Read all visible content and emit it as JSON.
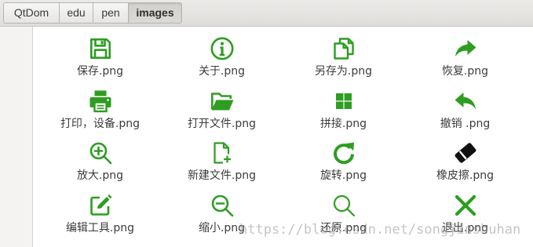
{
  "pathbar": {
    "segments": [
      {
        "label": "QtDom",
        "active": false
      },
      {
        "label": "edu",
        "active": false
      },
      {
        "label": "pen",
        "active": false
      },
      {
        "label": "images",
        "active": true
      }
    ]
  },
  "theme": {
    "icon_color": "#2e9d21",
    "eraser_color": "#111111"
  },
  "files": [
    {
      "name": "保存.png",
      "icon": "save-icon"
    },
    {
      "name": "关于.png",
      "icon": "info-icon"
    },
    {
      "name": "另存为.png",
      "icon": "copy-icon"
    },
    {
      "name": "恢复.png",
      "icon": "redo-icon"
    },
    {
      "name": "打印，设备.png",
      "icon": "printer-icon"
    },
    {
      "name": "打开文件.png",
      "icon": "open-folder-icon"
    },
    {
      "name": "拼接.png",
      "icon": "grid-icon"
    },
    {
      "name": "撤销 .png",
      "icon": "undo-icon"
    },
    {
      "name": "放大.png",
      "icon": "zoom-in-icon"
    },
    {
      "name": "新建文件.png",
      "icon": "new-file-icon"
    },
    {
      "name": "旋转.png",
      "icon": "rotate-icon"
    },
    {
      "name": "橡皮擦.png",
      "icon": "eraser-icon"
    },
    {
      "name": "编辑工具.png",
      "icon": "edit-icon"
    },
    {
      "name": "缩小.png",
      "icon": "zoom-out-icon"
    },
    {
      "name": "还原.png",
      "icon": "search-icon"
    },
    {
      "name": "退出.png",
      "icon": "close-icon"
    }
  ],
  "watermark": "https://blog.csdn.net/songjinshuhan"
}
